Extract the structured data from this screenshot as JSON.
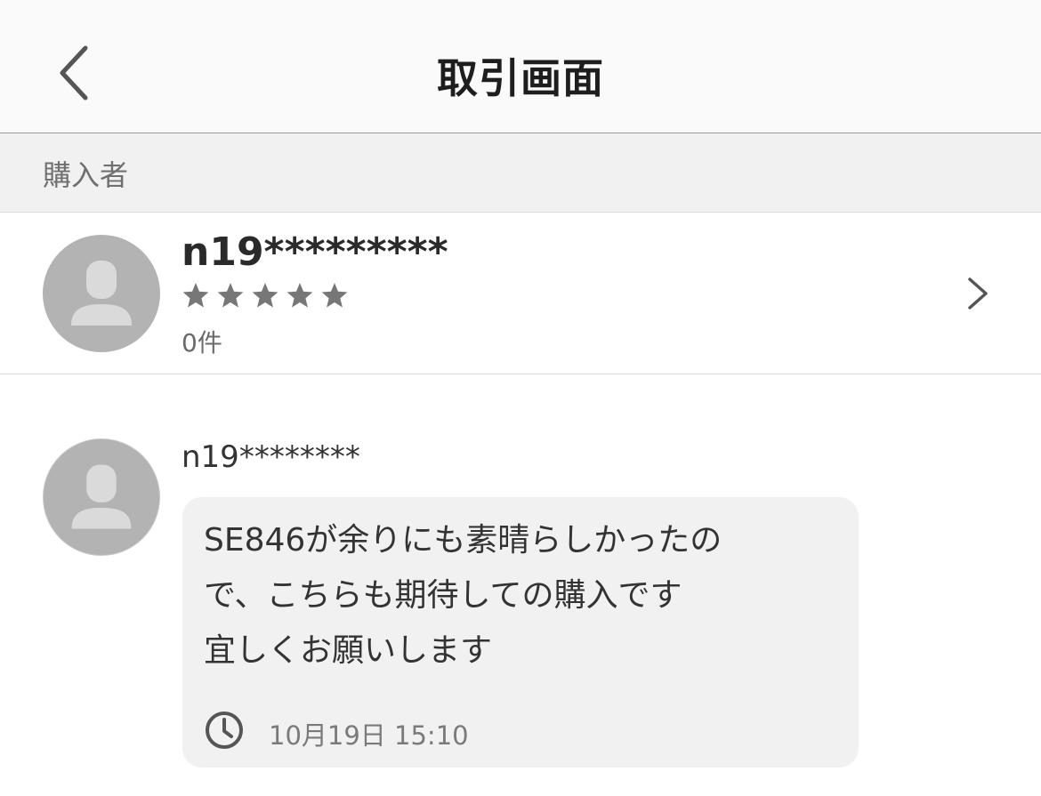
{
  "nav": {
    "title": "取引画面",
    "back_icon": "chevron-left-icon"
  },
  "section": {
    "label": "購入者"
  },
  "buyer": {
    "name": "n19*********",
    "rating_stars": 5,
    "rating_filled": 0,
    "review_count": "0件",
    "avatar_icon": "user-icon",
    "chevron_icon": "chevron-right-icon"
  },
  "message": {
    "sender": "n19********",
    "text": "SE846が余りにも素晴らしかったの\nで、こちらも期待しての購入です\n宜しくお願いします",
    "timestamp": "10月19日 15:10",
    "clock_icon": "clock-icon"
  },
  "colors": {
    "nav_bg": "#fbfafa",
    "section_bg": "#f1f1f1",
    "avatar_bg": "#b3b3b3",
    "star_color": "#777777",
    "bubble_bg": "#f1f1f1"
  }
}
